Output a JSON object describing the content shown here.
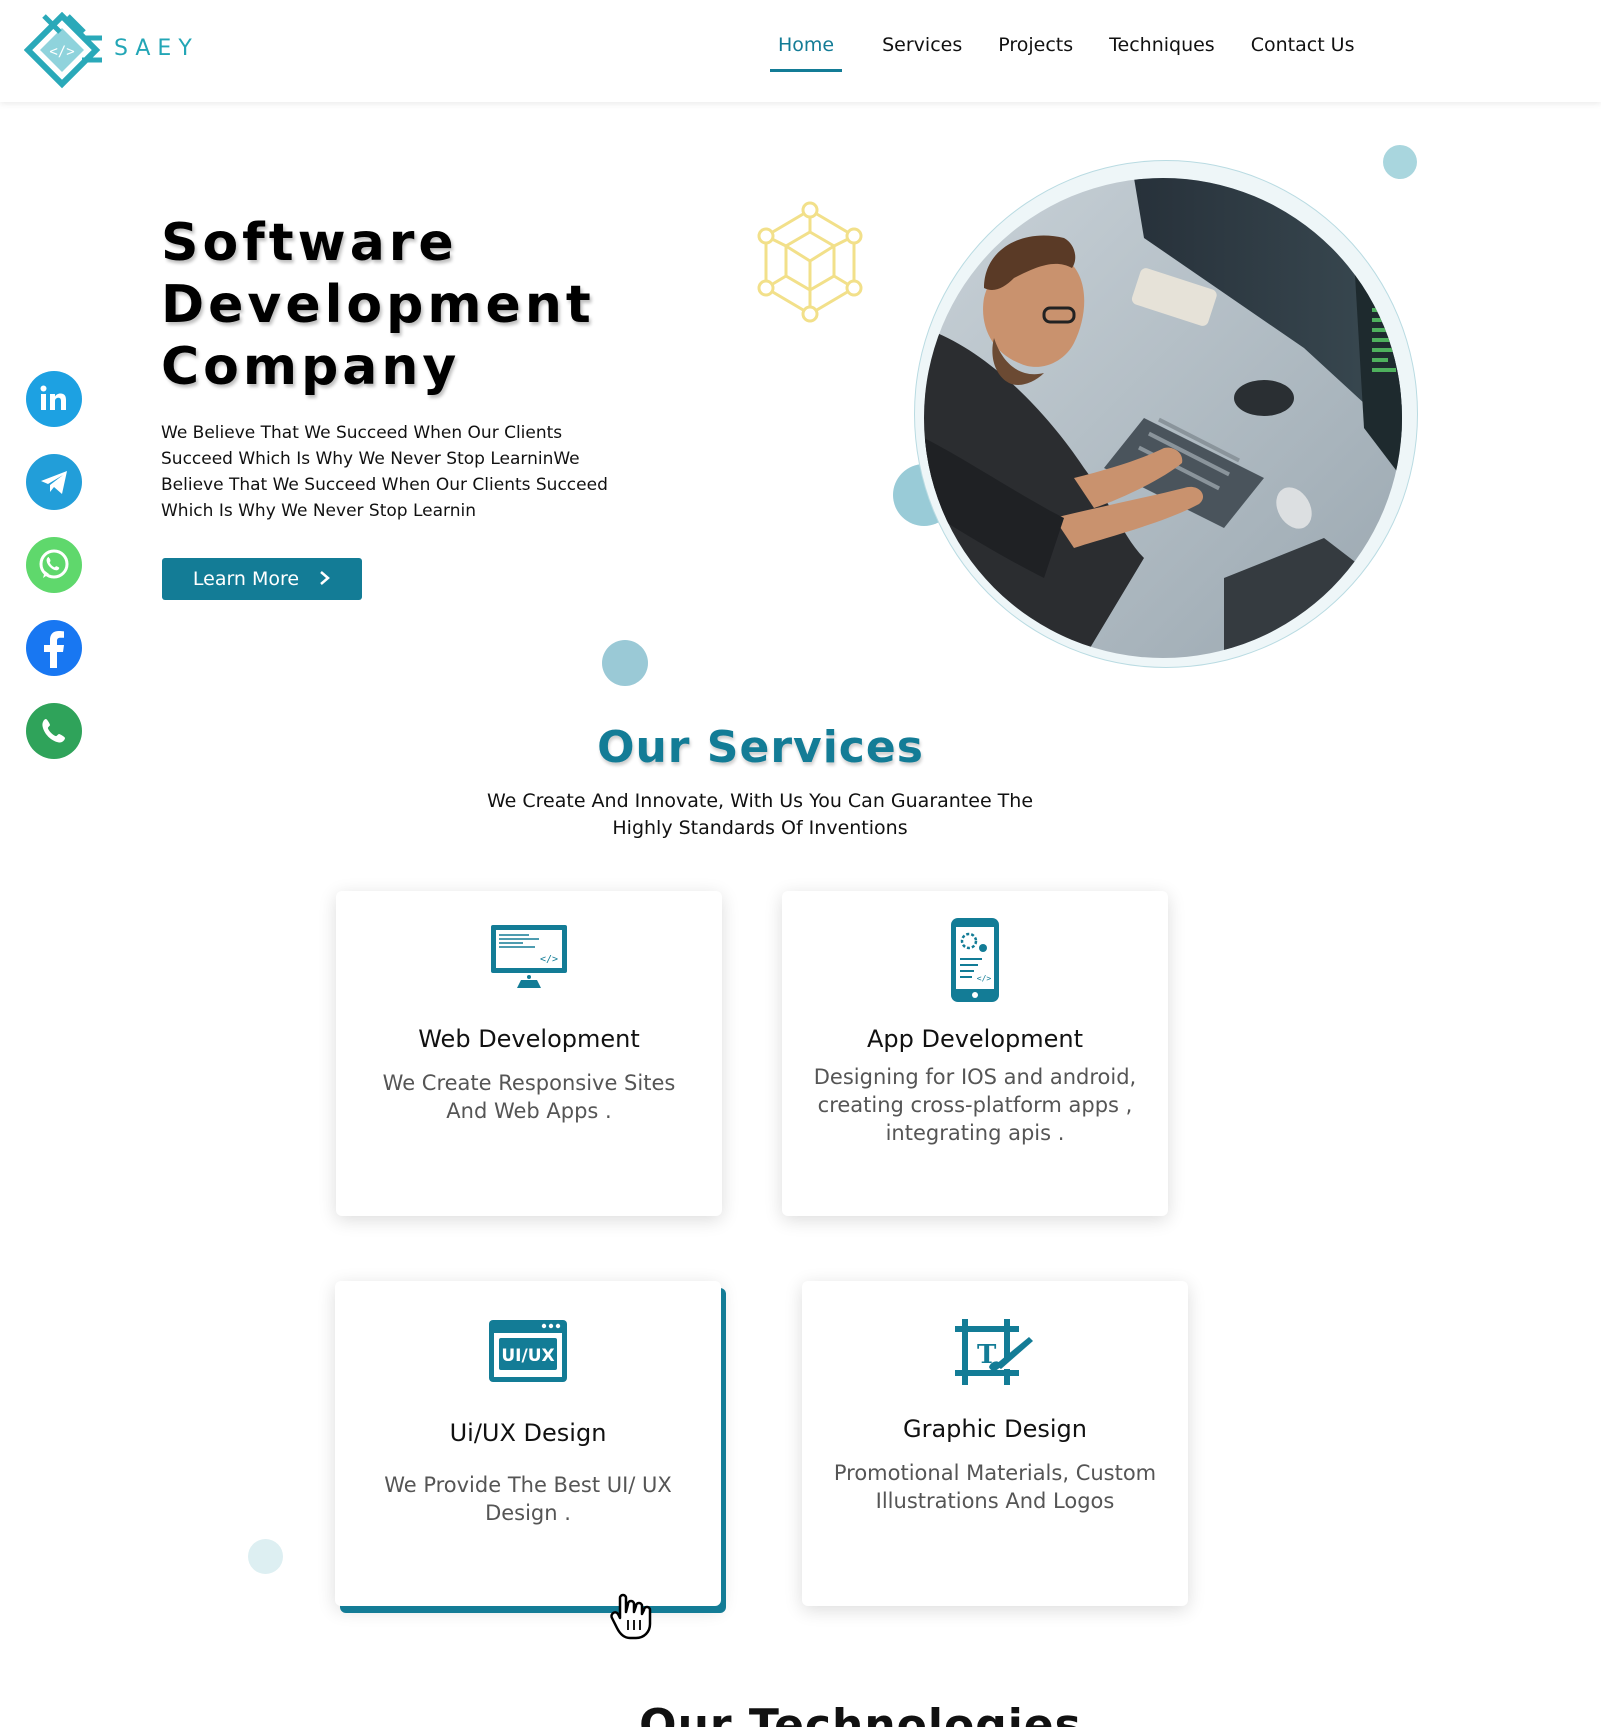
{
  "header": {
    "brand": "SAEY",
    "nav": [
      {
        "label": "Home",
        "active": true
      },
      {
        "label": "Services"
      },
      {
        "label": "Projects"
      },
      {
        "label": "Techniques"
      },
      {
        "label": "Contact Us"
      }
    ]
  },
  "social": [
    {
      "name": "linkedin",
      "color": "#1da1e2"
    },
    {
      "name": "telegram",
      "color": "#229ed9"
    },
    {
      "name": "whatsapp",
      "color": "#5fd86c"
    },
    {
      "name": "facebook",
      "color": "#1877f2"
    },
    {
      "name": "phone",
      "color": "#2fa35a"
    }
  ],
  "hero": {
    "title_lines": [
      "Software",
      "Development",
      "Company"
    ],
    "description": "We Believe That We Succeed When Our Clients Succeed Which Is Why We Never Stop LearninWe Believe That We Succeed When Our Clients Succeed Which Is Why We Never Stop Learnin",
    "cta_label": "Learn More"
  },
  "services": {
    "title": "Our Services",
    "subtitle": "We Create And Innovate, With Us You Can Guarantee The Highly Standards Of Inventions",
    "cards": [
      {
        "title": "Web Development",
        "description": "We Create Responsive Sites And Web Apps .",
        "icon": "monitor-code-icon"
      },
      {
        "title": "App Development",
        "description": "Designing for IOS and android, creating cross-platform apps , integrating apis .",
        "icon": "mobile-app-icon"
      },
      {
        "title": "Ui/UX Design",
        "description": "We Provide The Best UI/ UX Design .",
        "icon": "ui-ux-icon"
      },
      {
        "title": "Graphic Design",
        "description": "Promotional Materials, Custom Illustrations And Logos",
        "icon": "graphic-design-icon"
      }
    ]
  },
  "technologies": {
    "title": "Our Technologies"
  },
  "colors": {
    "accent": "#137c96",
    "brand": "#23a6b6"
  }
}
